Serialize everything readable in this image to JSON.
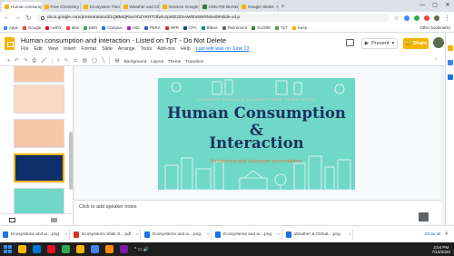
{
  "browser": {
    "tabs": [
      {
        "label": "Human consumption",
        "color": "#f4b400",
        "active": true
      },
      {
        "label": "Free Chemistry Google",
        "color": "#f4b400"
      },
      {
        "label": "Ecosystem Theme Goo",
        "color": "#f4b400"
      },
      {
        "label": "Weather and Climate",
        "color": "#f4b400"
      },
      {
        "label": "Science Google Slides",
        "color": "#f4b400"
      },
      {
        "label": "CREATE BUNDLE | Teac",
        "color": "#2e7d32"
      },
      {
        "label": "Google Slides",
        "color": "#f4b400"
      }
    ],
    "new_tab": "+",
    "url": "docs.google.com/presentation/d/1QBMdjRwcAhZYKRTOfwtvzpI5D2ZSAWbhI6WRM/edit#slide=id.p",
    "bookmarks": [
      {
        "label": "Apps",
        "color": "#4285f4"
      },
      {
        "label": "Google",
        "color": "#ea4335"
      },
      {
        "label": "netflix",
        "color": "#e50914"
      },
      {
        "label": "Mail",
        "color": "#ea4335"
      },
      {
        "label": "EMS",
        "color": "#34a853"
      },
      {
        "label": "Campus",
        "color": "#1a73e8"
      },
      {
        "label": "Hub",
        "color": "#9c27b0"
      },
      {
        "label": "PERA",
        "color": "#3f51b5"
      },
      {
        "label": "NPR",
        "color": "#d32f2f"
      },
      {
        "label": "CPA",
        "color": "#0d47a1"
      },
      {
        "label": "Bflexs",
        "color": "#00897b"
      },
      {
        "label": "Retirement",
        "color": "#5f6368"
      },
      {
        "label": "GLOBE",
        "color": "#2e7d32"
      },
      {
        "label": "TpT",
        "color": "#43a047"
      },
      {
        "label": "Keep",
        "color": "#f9ab00"
      }
    ],
    "other_bookmarks": "Other bookmarks"
  },
  "app": {
    "title": "Human consumption and interaction - Listed on TpT - Do Not Delete",
    "menus": [
      "File",
      "Edit",
      "View",
      "Insert",
      "Format",
      "Slide",
      "Arrange",
      "Tools",
      "Add-ons",
      "Help"
    ],
    "last_edit": "Last edit was on June 13",
    "present_label": "Present",
    "share_label": "Share"
  },
  "toolbar": {
    "background": "Background",
    "layout": "Layout",
    "theme": "Theme",
    "transition": "Transition"
  },
  "filmstrip": {
    "slides": [
      {
        "num": "",
        "color": "#1d3160"
      },
      {
        "num": "",
        "color": "#f6c8a8"
      },
      {
        "num": "",
        "color": "#f8d9c4"
      },
      {
        "num": "",
        "color": "#f6c8a8"
      },
      {
        "num": "",
        "color": "#0f2f6b"
      },
      {
        "num": "",
        "color": "#6fd8c8"
      }
    ]
  },
  "slide": {
    "subtitle_top": "SCIENCE GOOGLE SLIDES FROM TEMPLATES",
    "title_line1": "Human Consumption &",
    "title_line2": "Interaction",
    "subtitle_bottom": "for planning and classroom presentations"
  },
  "notes": {
    "placeholder": "Click to add speaker notes"
  },
  "downloads": {
    "items": [
      {
        "label": "Ecosystems and w....png",
        "color": "#1a73e8"
      },
      {
        "label": "Ecosystems Slide S....pdf",
        "color": "#d93025"
      },
      {
        "label": "Ecosystems and w....png",
        "color": "#1a73e8"
      },
      {
        "label": "Ecosystems and w....png",
        "color": "#1a73e8"
      },
      {
        "label": "Weather & Climat....png",
        "color": "#1a73e8"
      }
    ],
    "show_all": "Show all",
    "close": "✕"
  },
  "taskbar": {
    "time": "3:04 PM",
    "date": "7/16/2020",
    "icons": [
      "#ffb900",
      "#0078d7",
      "#e81123",
      "#34a853",
      "#f4b400",
      "#4285f4",
      "#ff8c00",
      "#7719aa"
    ]
  }
}
